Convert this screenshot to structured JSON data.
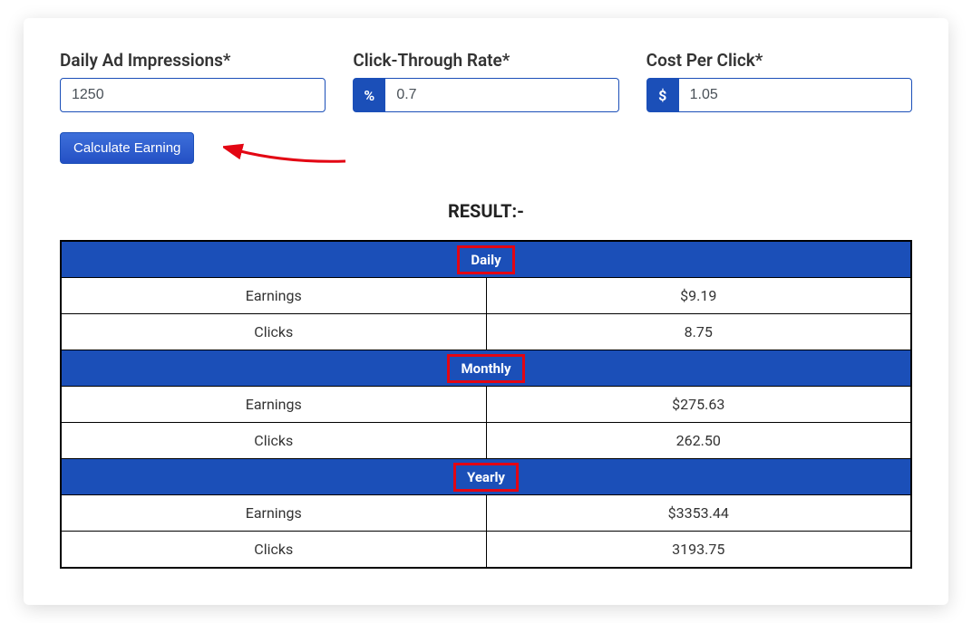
{
  "form": {
    "impressions": {
      "label": "Daily Ad Impressions*",
      "value": "1250"
    },
    "ctr": {
      "label": "Click-Through Rate*",
      "prefix": "%",
      "value": "0.7"
    },
    "cpc": {
      "label": "Cost Per Click*",
      "prefix": "$",
      "value": "1.05"
    },
    "button": "Calculate Earning"
  },
  "result": {
    "title": "RESULT:-",
    "sections": [
      {
        "name": "Daily",
        "earnings_label": "Earnings",
        "earnings": "$9.19",
        "clicks_label": "Clicks",
        "clicks": "8.75"
      },
      {
        "name": "Monthly",
        "earnings_label": "Earnings",
        "earnings": "$275.63",
        "clicks_label": "Clicks",
        "clicks": "262.50"
      },
      {
        "name": "Yearly",
        "earnings_label": "Earnings",
        "earnings": "$3353.44",
        "clicks_label": "Clicks",
        "clicks": "3193.75"
      }
    ]
  }
}
